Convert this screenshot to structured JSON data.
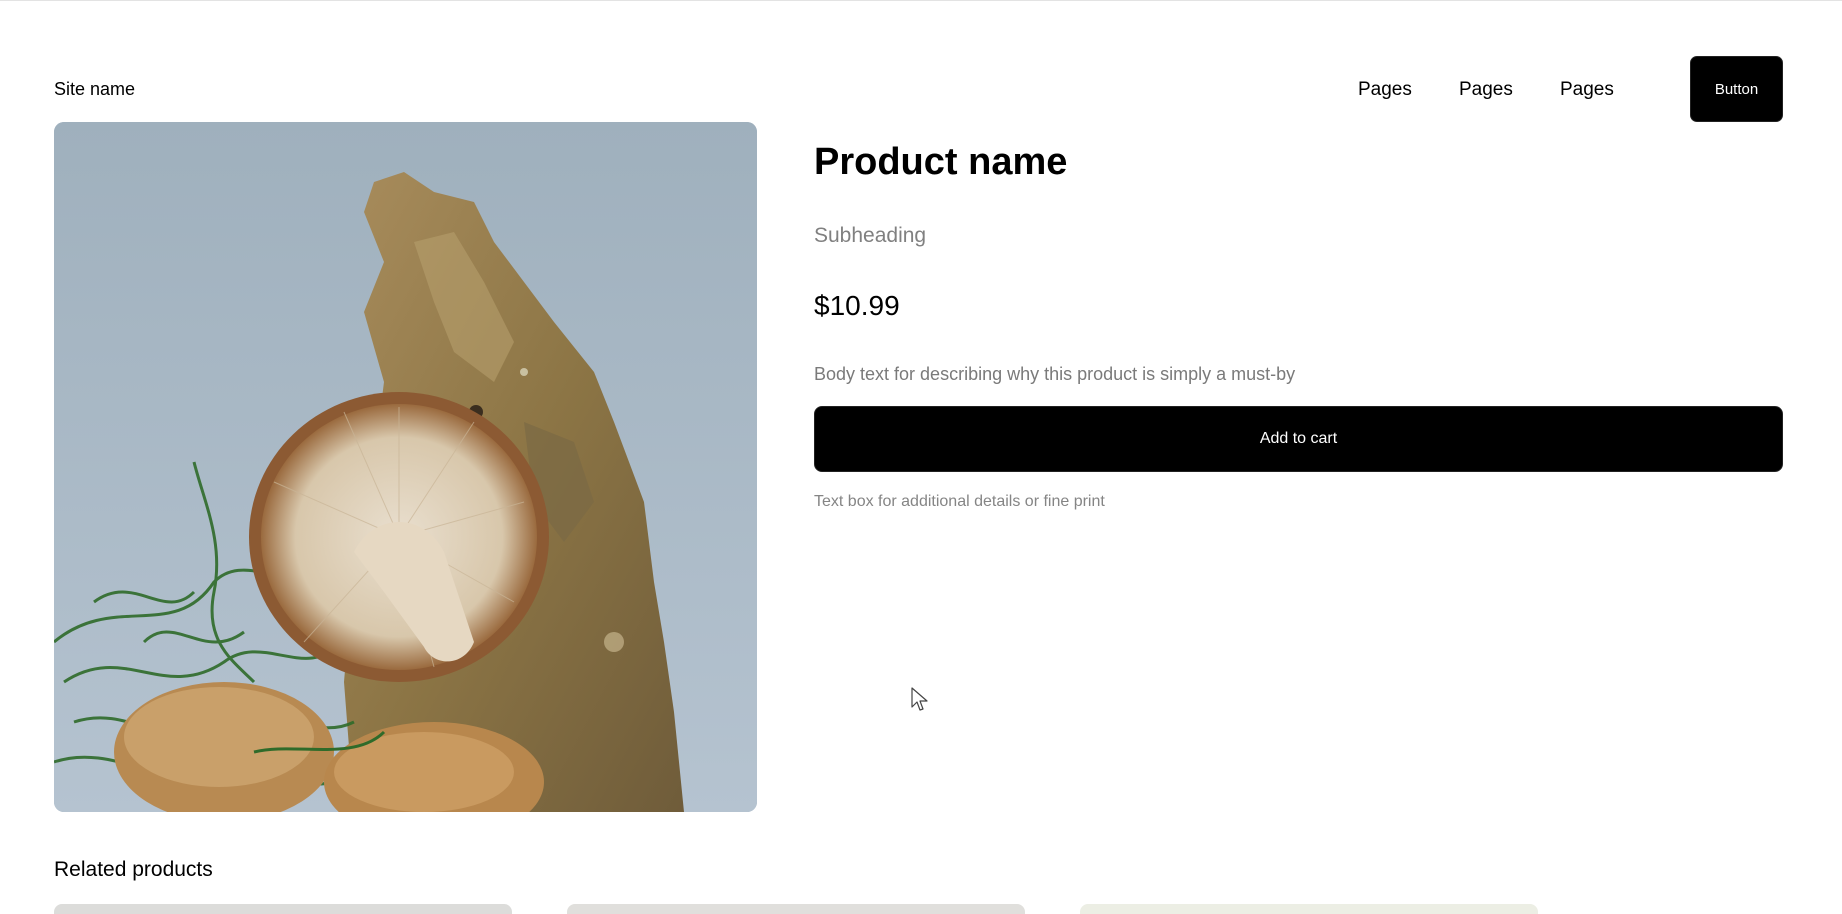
{
  "header": {
    "site_name": "Site name",
    "nav": [
      {
        "label": "Pages"
      },
      {
        "label": "Pages"
      },
      {
        "label": "Pages"
      }
    ],
    "button_label": "Button"
  },
  "product": {
    "image_alt": "Shiitake mushrooms with cork bark and green moss",
    "name": "Product name",
    "subheading": "Subheading",
    "price": "$10.99",
    "body": "Body text for describing why this product is simply a must-by",
    "add_to_cart_label": "Add to cart",
    "fine_print": "Text box for additional details or fine print"
  },
  "related": {
    "title": "Related products"
  },
  "colors": {
    "accent": "#000000",
    "muted_text": "#808080",
    "image_background": "#a7b6c4"
  }
}
